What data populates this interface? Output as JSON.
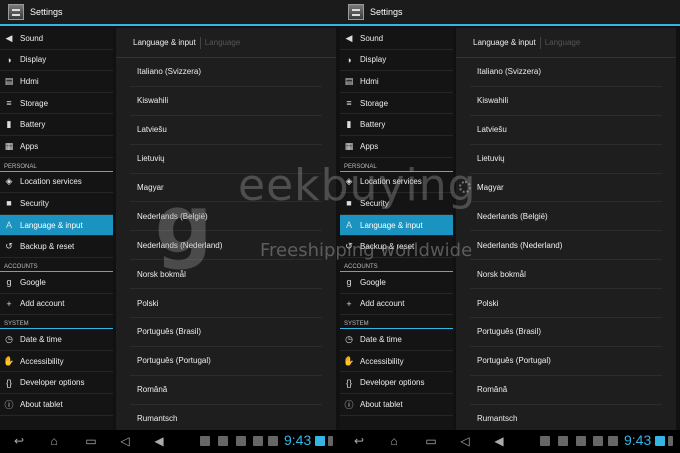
{
  "app_title": "Settings",
  "sidebar": {
    "groups": [
      {
        "header": "",
        "items": [
          {
            "label": "Sound",
            "icon": "speaker-icon",
            "glyph": "◀"
          },
          {
            "label": "Display",
            "icon": "display-icon",
            "glyph": "◑"
          },
          {
            "label": "Hdmi",
            "icon": "hdmi-icon",
            "glyph": "▤"
          },
          {
            "label": "Storage",
            "icon": "storage-icon",
            "glyph": "≡"
          },
          {
            "label": "Battery",
            "icon": "battery-icon",
            "glyph": "▮"
          },
          {
            "label": "Apps",
            "icon": "apps-icon",
            "glyph": "▦"
          }
        ]
      },
      {
        "header": "PERSONAL",
        "items": [
          {
            "label": "Location services",
            "icon": "location-icon",
            "glyph": "◈"
          },
          {
            "label": "Security",
            "icon": "lock-icon",
            "glyph": "■"
          },
          {
            "label": "Language & input",
            "icon": "keyboard-icon",
            "glyph": "A",
            "active": true
          },
          {
            "label": "Backup & reset",
            "icon": "backup-icon",
            "glyph": "↺"
          }
        ]
      },
      {
        "header": "ACCOUNTS",
        "items": [
          {
            "label": "Google",
            "icon": "google-icon",
            "glyph": "g"
          },
          {
            "label": "Add account",
            "icon": "plus-icon",
            "glyph": "+"
          }
        ]
      },
      {
        "header": "SYSTEM",
        "items": [
          {
            "label": "Date & time",
            "icon": "clock-icon",
            "glyph": "◷"
          },
          {
            "label": "Accessibility",
            "icon": "hand-icon",
            "glyph": "✋"
          },
          {
            "label": "Developer options",
            "icon": "code-icon",
            "glyph": "{}"
          },
          {
            "label": "About tablet",
            "icon": "info-icon",
            "glyph": "ⓘ"
          }
        ]
      }
    ]
  },
  "content": {
    "breadcrumb": "Language & input",
    "subtitle": "Language",
    "languages": [
      "Italiano (Svizzera)",
      "Kiswahili",
      "Latviešu",
      "Lietuvių",
      "Magyar",
      "Nederlands (België)",
      "Nederlands (Nederland)",
      "Norsk bokmål",
      "Polski",
      "Português (Brasil)",
      "Português (Portugal)",
      "Română",
      "Rumantsch"
    ]
  },
  "watermark": {
    "text": "eekbuying",
    "subtext": "Freeshipping worldwide"
  },
  "status_bar": {
    "time": "9:43"
  },
  "colors": {
    "accent": "#33b5e5",
    "active_item": "#1a93c0"
  }
}
